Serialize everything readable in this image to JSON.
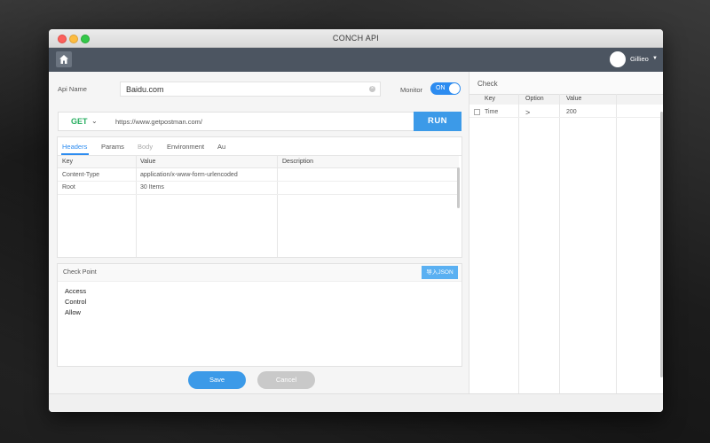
{
  "window": {
    "title": "CONCH API"
  },
  "header": {
    "username": "Gillieo",
    "home_icon": "home-icon"
  },
  "api": {
    "name_label": "Api Name",
    "name_value": "Baidu.com",
    "monitor_label": "Monitor",
    "monitor_toggle": "ON"
  },
  "request": {
    "method": "GET",
    "url": "https://www.getpostman.com/",
    "run_label": "RUN"
  },
  "tabs": [
    "Headers",
    "Params",
    "Body",
    "Environment",
    "Au"
  ],
  "params_table": {
    "columns": [
      "Key",
      "Value",
      "Description"
    ],
    "rows": [
      {
        "key": "Content-Type",
        "value": "application/x-www-form-urlencoded",
        "description": ""
      },
      {
        "key": "Root",
        "value": "30 Items",
        "description": ""
      }
    ]
  },
  "check_point": {
    "title": "Check Point",
    "import_label": "导入JSON",
    "lines": [
      "Access",
      "Control",
      "Allow"
    ]
  },
  "buttons": {
    "save": "Save",
    "cancel": "Cancel"
  },
  "check": {
    "title": "Check",
    "columns": [
      "Key",
      "Option",
      "Value"
    ],
    "rows": [
      {
        "key": "Time",
        "option": ">",
        "value": "200"
      }
    ]
  },
  "colors": {
    "accent": "#3c9ae8",
    "appbar": "#4c5561",
    "method_green": "#27ae60"
  }
}
